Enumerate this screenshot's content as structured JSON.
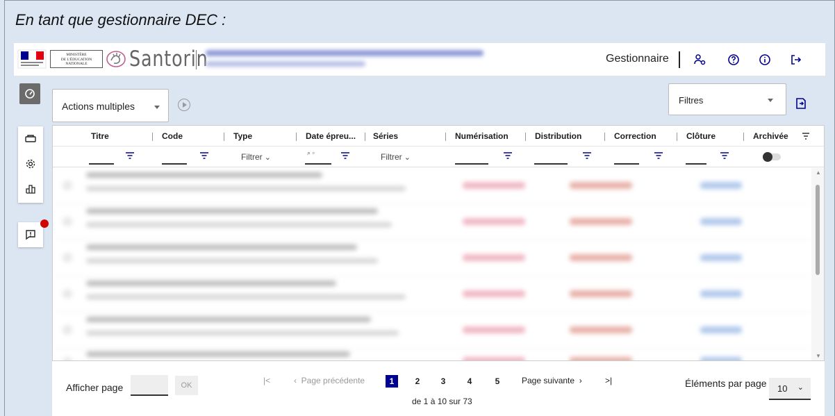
{
  "caption": "En tant que gestionnaire DEC :",
  "header": {
    "ministere_lines": [
      "MINISTÈRE",
      "DE L'ÉDUCATION",
      "NATIONALE"
    ],
    "brand": "Santorin",
    "role": "Gestionnaire",
    "icons": [
      "users-settings-icon",
      "help-icon",
      "info-icon",
      "logout-icon"
    ]
  },
  "sidebar": {
    "items": [
      "dashboard-icon",
      "exam-icon",
      "settings-icon",
      "stats-icon",
      "feedback-icon"
    ]
  },
  "toolbar": {
    "actions_label": "Actions multiples",
    "filters_label": "Filtres"
  },
  "table": {
    "columns": [
      "Titre",
      "Code",
      "Type",
      "Date épreu...",
      "Séries",
      "Numérisation",
      "Distribution",
      "Correction",
      "Clôture",
      "Archivée"
    ],
    "filter_dropdown_label": "Filtrer"
  },
  "pager": {
    "show_page_label": "Afficher page",
    "ok_label": "OK",
    "prev_label": "Page précédente",
    "next_label": "Page suivante",
    "pages": [
      "1",
      "2",
      "3",
      "4",
      "5"
    ],
    "current_page": "1",
    "range_text": "de 1 à 10 sur 73",
    "per_page_label": "Éléments par page",
    "per_page_value": "10"
  },
  "colors": {
    "primary": "#000091",
    "danger": "#ce0500",
    "background": "#dce6f3"
  }
}
